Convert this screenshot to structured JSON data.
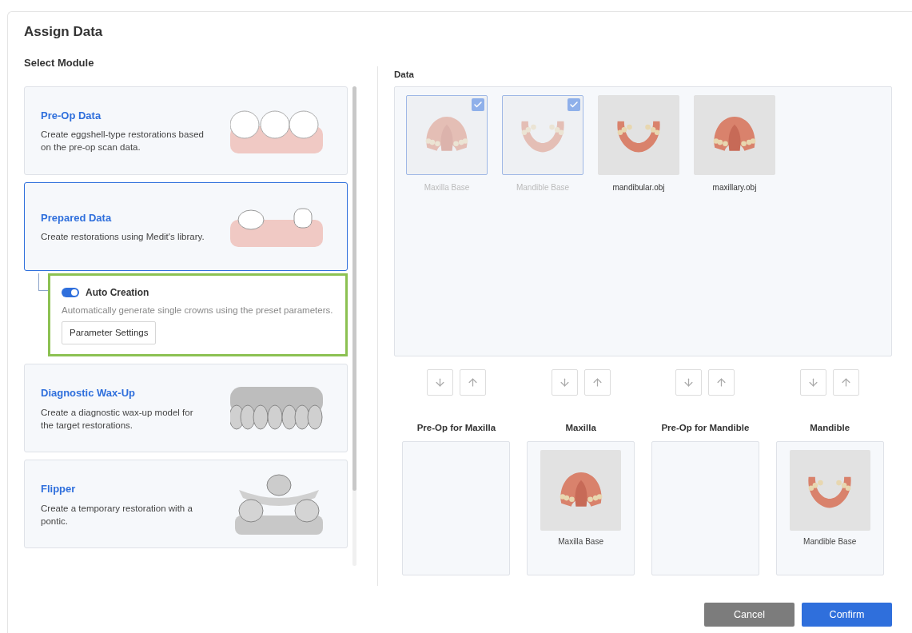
{
  "dialog": {
    "title": "Assign Data"
  },
  "modules": {
    "heading": "Select Module",
    "items": [
      {
        "kind": "crowns",
        "title": "Pre-Op Data",
        "description": "Create eggshell-type restorations based on the pre-op scan data.",
        "selected": false
      },
      {
        "kind": "prepared",
        "title": "Prepared Data",
        "description": "Create restorations using Medit's library.",
        "selected": true,
        "option": {
          "title": "Auto Creation",
          "on": true,
          "description": "Automatically generate single crowns using the preset parameters.",
          "button": "Parameter Settings",
          "highlighted": true
        }
      },
      {
        "kind": "waxup",
        "title": "Diagnostic Wax-Up",
        "description": "Create a diagnostic wax-up model for the target restorations.",
        "selected": false
      },
      {
        "kind": "flipper",
        "title": "Flipper",
        "description": "Create a temporary restoration with a pontic.",
        "selected": false
      }
    ]
  },
  "data": {
    "heading": "Data",
    "items": [
      {
        "label": "Maxilla Base",
        "checked": true,
        "kind": "upper"
      },
      {
        "label": "Mandible Base",
        "checked": true,
        "kind": "lower"
      },
      {
        "label": "mandibular.obj",
        "checked": false,
        "kind": "lower"
      },
      {
        "label": "maxillary.obj",
        "checked": false,
        "kind": "upper"
      }
    ]
  },
  "slots": [
    {
      "title": "Pre-Op for Maxilla"
    },
    {
      "title": "Maxilla",
      "item": {
        "label": "Maxilla Base",
        "kind": "upper"
      }
    },
    {
      "title": "Pre-Op for Mandible"
    },
    {
      "title": "Mandible",
      "item": {
        "label": "Mandible Base",
        "kind": "lower"
      }
    }
  ],
  "buttons": {
    "cancel": "Cancel",
    "confirm": "Confirm"
  }
}
